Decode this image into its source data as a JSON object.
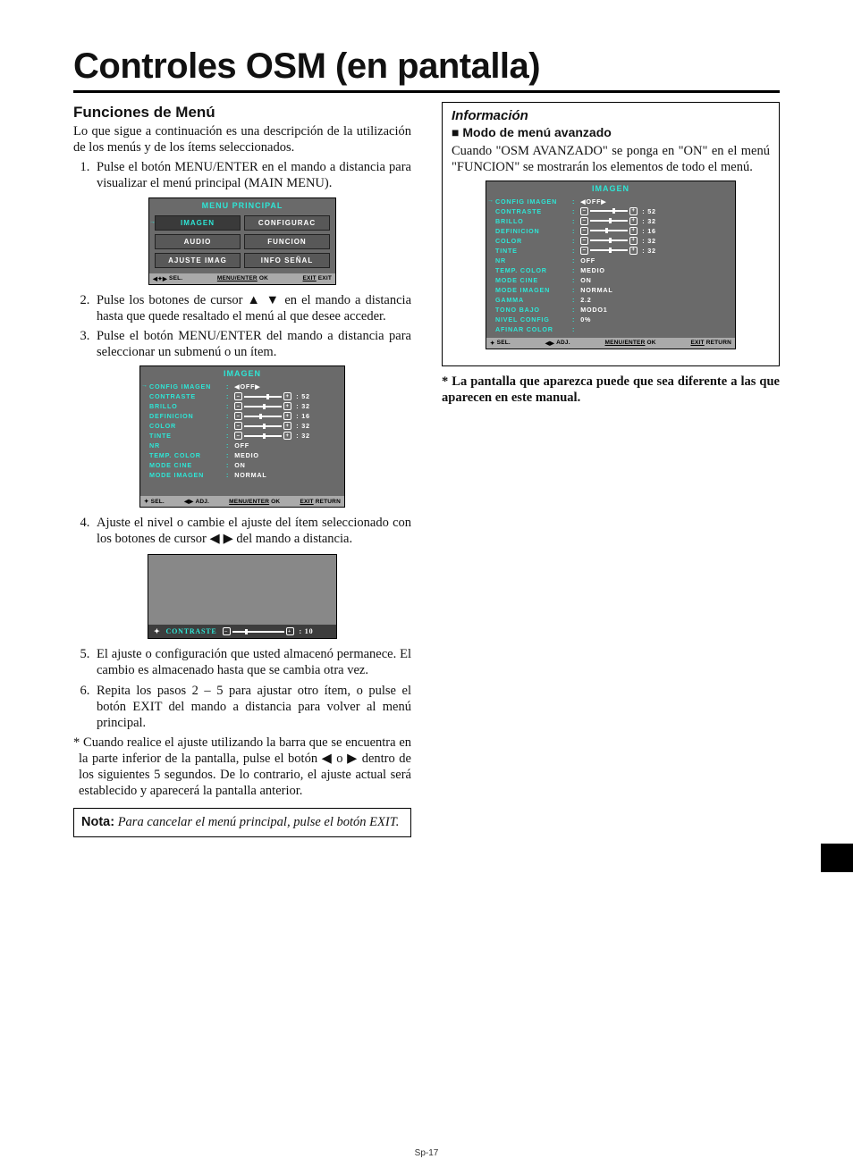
{
  "page_number": "Sp-17",
  "title": "Controles OSM (en pantalla)",
  "left": {
    "heading": "Funciones de Menú",
    "intro": "Lo que sigue a continuación es una descripción de la utilización de los menús y de los ítems seleccionados.",
    "step1": "Pulse el botón MENU/ENTER en el mando a distancia para visualizar el menú principal (MAIN MENU).",
    "step2a": "Pulse los botones de cursor ",
    "step2b": " en el mando a distancia hasta que quede resaltado el menú al que desee acceder.",
    "step3": "Pulse el botón MENU/ENTER del mando a distancia para seleccionar un submenú o un ítem.",
    "step4a": "Ajuste el nivel o cambie el ajuste del ítem seleccionado con los botones de cursor ",
    "step4b": " del mando a distancia.",
    "step5": "El ajuste o configuración que usted almacenó permanece. El cambio es almacenado hasta que se cambia otra vez.",
    "step6": "Repita los pasos 2 – 5 para ajustar otro ítem, o pulse el botón EXIT del mando a distancia para volver al menú principal.",
    "star_a": "Cuando realice el ajuste utilizando la barra que se encuentra en la parte inferior de la pantalla, pulse el botón ",
    "star_mid": " o ",
    "star_b": " dentro de los siguientes 5 segundos. De lo contrario, el ajuste actual será establecido y aparecerá la pantalla anterior.",
    "note_lead": "Nota:",
    "note_body": " Para cancelar el menú principal, pulse el botón EXIT."
  },
  "right": {
    "info_heading": "Información",
    "sub_heading": "Modo de menú avanzado",
    "info_body": "Cuando \"OSM AVANZADO\" se ponga en \"ON\" en el menú \"FUNCION\" se mostrarán los elementos de todo el menú.",
    "foot_star": "* La pantalla que aparezca puede que sea diferente a las que aparecen en este manual."
  },
  "glyphs": {
    "up": "▲",
    "down": "▼",
    "left": "◀",
    "right": "▶",
    "updown": "▲ ▼",
    "leftright": "◀ ▶"
  },
  "osd_main": {
    "title": "MENU PRINCIPAL",
    "cells": [
      "IMAGEN",
      "CONFIGURAC",
      "AUDIO",
      "FUNCION",
      "AJUSTE IMAG",
      "INFO SEÑAL"
    ],
    "footer": {
      "sel": "SEL.",
      "ok_l": "MENU/ENTER",
      "ok": "OK",
      "exit_l": "EXIT",
      "exit": "EXIT"
    }
  },
  "osd_imagen": {
    "title": "IMAGEN",
    "rows": [
      {
        "label": "CONFIG IMAGEN",
        "type": "text",
        "value": "◀OFF▶",
        "sel": true
      },
      {
        "label": "CONTRASTE",
        "type": "slider",
        "value": "52",
        "pos": 60
      },
      {
        "label": "BRILLO",
        "type": "slider",
        "value": "32",
        "pos": 50
      },
      {
        "label": "DEFINICION",
        "type": "slider",
        "value": "16",
        "pos": 40
      },
      {
        "label": "COLOR",
        "type": "slider",
        "value": "32",
        "pos": 50
      },
      {
        "label": "TINTE",
        "type": "slider",
        "value": "32",
        "pos": 50
      },
      {
        "label": "NR",
        "type": "text",
        "value": "OFF"
      },
      {
        "label": "TEMP. COLOR",
        "type": "text",
        "value": "MEDIO"
      },
      {
        "label": "MODE CINE",
        "type": "text",
        "value": "ON"
      },
      {
        "label": "MODE IMAGEN",
        "type": "text",
        "value": "NORMAL"
      }
    ],
    "footer": {
      "sel": "SEL.",
      "adj": "ADJ.",
      "ok_l": "MENU/ENTER",
      "ok": "OK",
      "exit_l": "EXIT",
      "exit": "RETURN"
    }
  },
  "osd_contrast": {
    "label": "CONTRASTE",
    "value": "10",
    "pos": 25
  },
  "osd_imagen_adv": {
    "title": "IMAGEN",
    "rows": [
      {
        "label": "CONFIG IMAGEN",
        "type": "text",
        "value": "◀OFF▶",
        "sel": true
      },
      {
        "label": "CONTRASTE",
        "type": "slider",
        "value": "52",
        "pos": 60
      },
      {
        "label": "BRILLO",
        "type": "slider",
        "value": "32",
        "pos": 50
      },
      {
        "label": "DEFINICION",
        "type": "slider",
        "value": "16",
        "pos": 40
      },
      {
        "label": "COLOR",
        "type": "slider",
        "value": "32",
        "pos": 50
      },
      {
        "label": "TINTE",
        "type": "slider",
        "value": "32",
        "pos": 50
      },
      {
        "label": "NR",
        "type": "text",
        "value": "OFF"
      },
      {
        "label": "TEMP. COLOR",
        "type": "text",
        "value": "MEDIO"
      },
      {
        "label": "MODE CINE",
        "type": "text",
        "value": "ON"
      },
      {
        "label": "MODE IMAGEN",
        "type": "text",
        "value": "NORMAL"
      },
      {
        "label": "GAMMA",
        "type": "text",
        "value": "2.2"
      },
      {
        "label": "TONO BAJO",
        "type": "text",
        "value": "MODO1"
      },
      {
        "label": "NIVEL CONFIG",
        "type": "text",
        "value": "0%"
      },
      {
        "label": "AFINAR COLOR",
        "type": "text",
        "value": ""
      }
    ],
    "footer": {
      "sel": "SEL.",
      "adj": "ADJ.",
      "ok_l": "MENU/ENTER",
      "ok": "OK",
      "exit_l": "EXIT",
      "exit": "RETURN"
    }
  }
}
